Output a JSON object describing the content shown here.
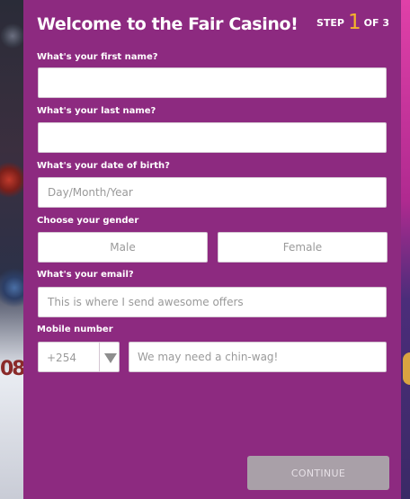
{
  "modal": {
    "title": "Welcome to the Fair Casino!",
    "step": {
      "prefix": "STEP",
      "current": "1",
      "suffix": "OF 3"
    }
  },
  "form": {
    "first_name": {
      "label": "What's your first name?",
      "value": "",
      "placeholder": ""
    },
    "last_name": {
      "label": "What's your last name?",
      "value": "",
      "placeholder": ""
    },
    "dob": {
      "label": "What's your date of birth?",
      "placeholder": "Day/Month/Year"
    },
    "gender": {
      "label": "Choose your gender",
      "options": [
        "Male",
        "Female"
      ]
    },
    "email": {
      "label": "What's your email?",
      "placeholder": "This is where I send awesome offers"
    },
    "mobile": {
      "label": "Mobile number",
      "country_code": "+254",
      "placeholder": "We may need a chin-wag!"
    }
  },
  "actions": {
    "continue_label": "CONTINUE"
  },
  "colors": {
    "modal_bg": "#8d2a80",
    "step_accent": "#f5b32b",
    "disabled_button": "#a9a0a8",
    "input_bg": "#ffffff"
  },
  "icons": {
    "country_dropdown": "chevron-down-icon"
  }
}
